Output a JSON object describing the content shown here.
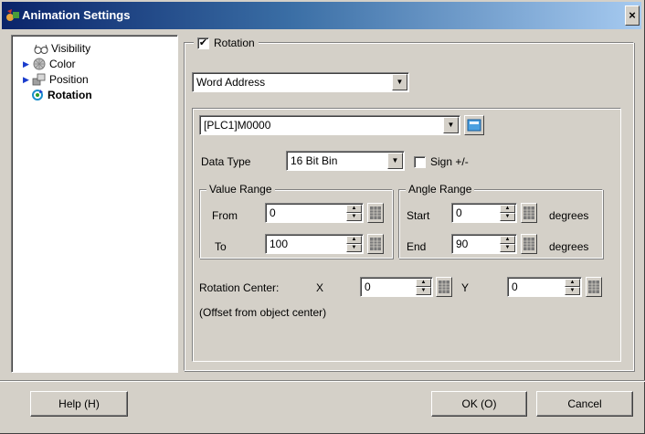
{
  "window": {
    "title": "Animation Settings",
    "close_label": "×"
  },
  "tree": {
    "items": [
      {
        "label": "Visibility",
        "icon": "glasses-icon",
        "expandable": false
      },
      {
        "label": "Color",
        "icon": "color-wheel-icon",
        "expandable": true
      },
      {
        "label": "Position",
        "icon": "position-icon",
        "expandable": true
      },
      {
        "label": "Rotation",
        "icon": "rotation-icon",
        "expandable": false,
        "selected": true
      }
    ]
  },
  "rotation": {
    "enable_label": "Rotation",
    "enabled": true,
    "mode_value": "Word Address",
    "address_value": "[PLC1]M0000",
    "data_type_label": "Data Type",
    "data_type_value": "16 Bit Bin",
    "sign_label": "Sign +/-",
    "sign_checked": false
  },
  "value_range": {
    "title": "Value Range",
    "from_label": "From",
    "from_value": "0",
    "to_label": "To",
    "to_value": "100"
  },
  "angle_range": {
    "title": "Angle Range",
    "start_label": "Start",
    "start_value": "0",
    "end_label": "End",
    "end_value": "90",
    "unit_label": "degrees"
  },
  "center": {
    "label": "Rotation Center:",
    "x_label": "X",
    "x_value": "0",
    "y_label": "Y",
    "y_value": "0",
    "note": "(Offset from object center)"
  },
  "buttons": {
    "help": "Help (H)",
    "ok": "OK (O)",
    "cancel": "Cancel"
  },
  "colors": {
    "title_start": "#0a246a",
    "title_end": "#a6caf0",
    "face": "#d4d0c8",
    "accent": "#1a3ccc"
  }
}
